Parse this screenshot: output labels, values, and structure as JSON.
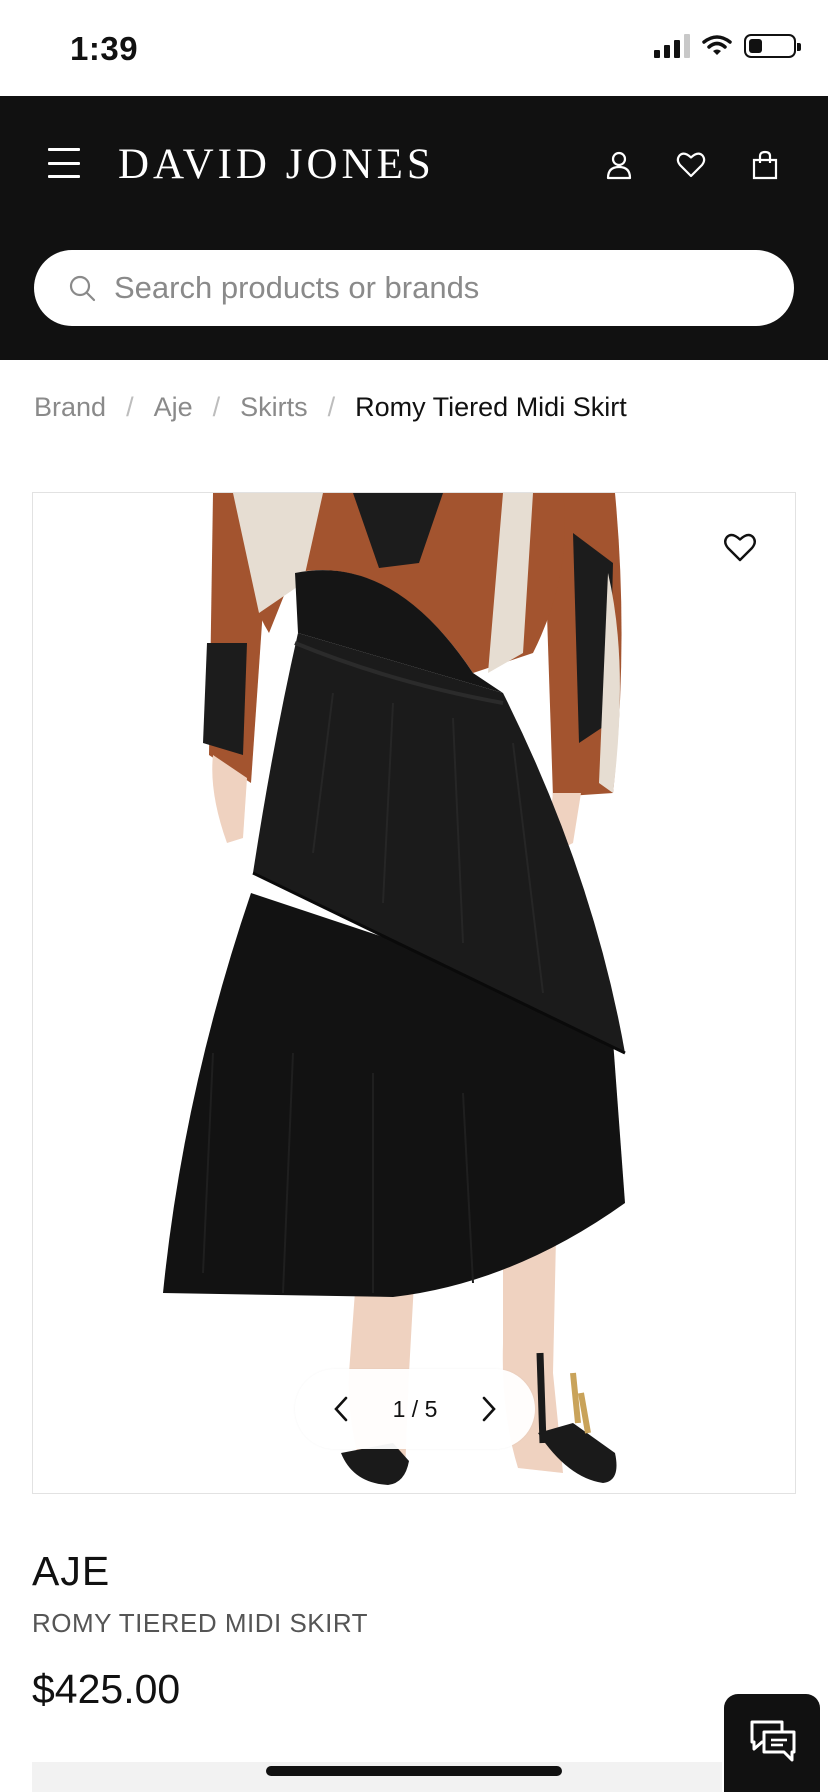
{
  "status_bar": {
    "time": "1:39",
    "battery_level": 0.3,
    "signal_bars": 3
  },
  "header": {
    "logo": "DAVID JONES",
    "icons": [
      "menu-icon",
      "account-icon",
      "wishlist-icon",
      "shopping-bag-icon"
    ]
  },
  "search": {
    "placeholder": "Search products or brands",
    "value": ""
  },
  "breadcrumb": {
    "items": [
      "Brand",
      "Aje",
      "Skirts"
    ],
    "separator": "/",
    "current": "Romy Tiered Midi Skirt"
  },
  "gallery": {
    "pager": "1 / 5",
    "current": 1,
    "total": 5
  },
  "product": {
    "brand": "AJE",
    "name": "ROMY TIERED MIDI SKIRT",
    "price": "$425.00"
  },
  "colors": {
    "header_bg": "#111111",
    "text": "#111111",
    "muted": "#8a8a8a"
  }
}
